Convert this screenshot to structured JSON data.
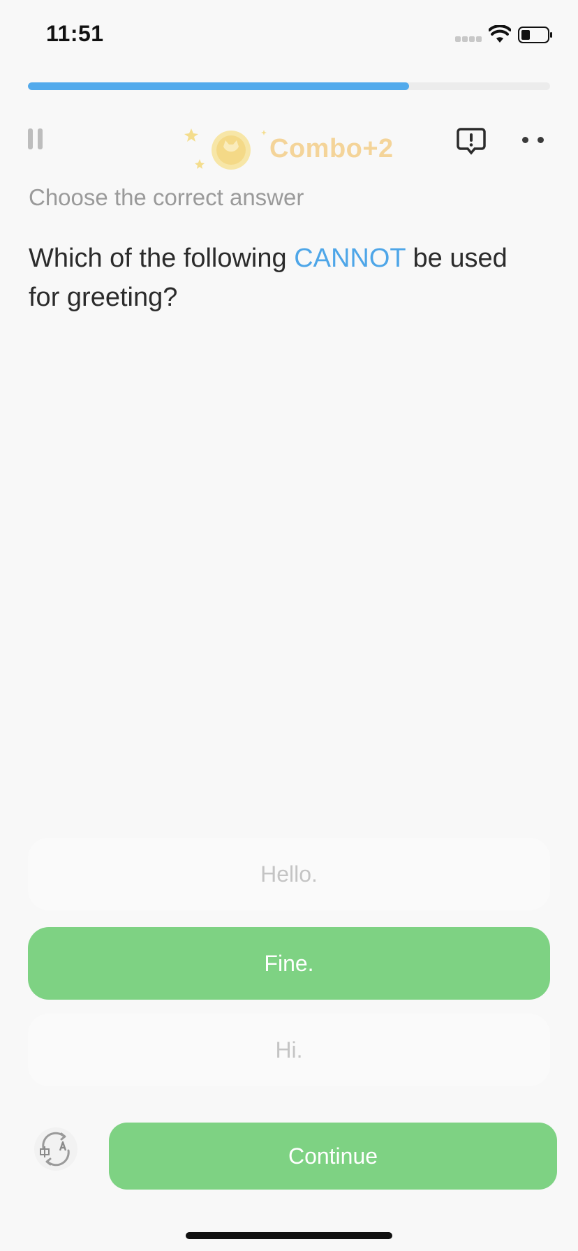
{
  "status_bar": {
    "time": "11:51",
    "icons": [
      "cellular-signal-icon",
      "wifi-icon",
      "battery-icon"
    ]
  },
  "progress": {
    "fraction": 0.73,
    "fill_color": "#52aaec"
  },
  "header": {
    "combo_label": "Combo+2",
    "icons": [
      "pause-icon",
      "coin-icon",
      "report-icon",
      "more-icon"
    ]
  },
  "exercise": {
    "instruction": "Choose the correct answer",
    "question_before": "Which of the following ",
    "question_highlight": "CANNOT",
    "question_after": " be used for greeting?",
    "highlight_color": "#4ea6e8"
  },
  "options": [
    {
      "label": "Hello.",
      "selected": false
    },
    {
      "label": "Fine.",
      "selected": true
    },
    {
      "label": "Hi.",
      "selected": false
    }
  ],
  "footer": {
    "continue_label": "Continue",
    "accent_color": "#7ed283",
    "icons": [
      "translate-icon"
    ]
  }
}
